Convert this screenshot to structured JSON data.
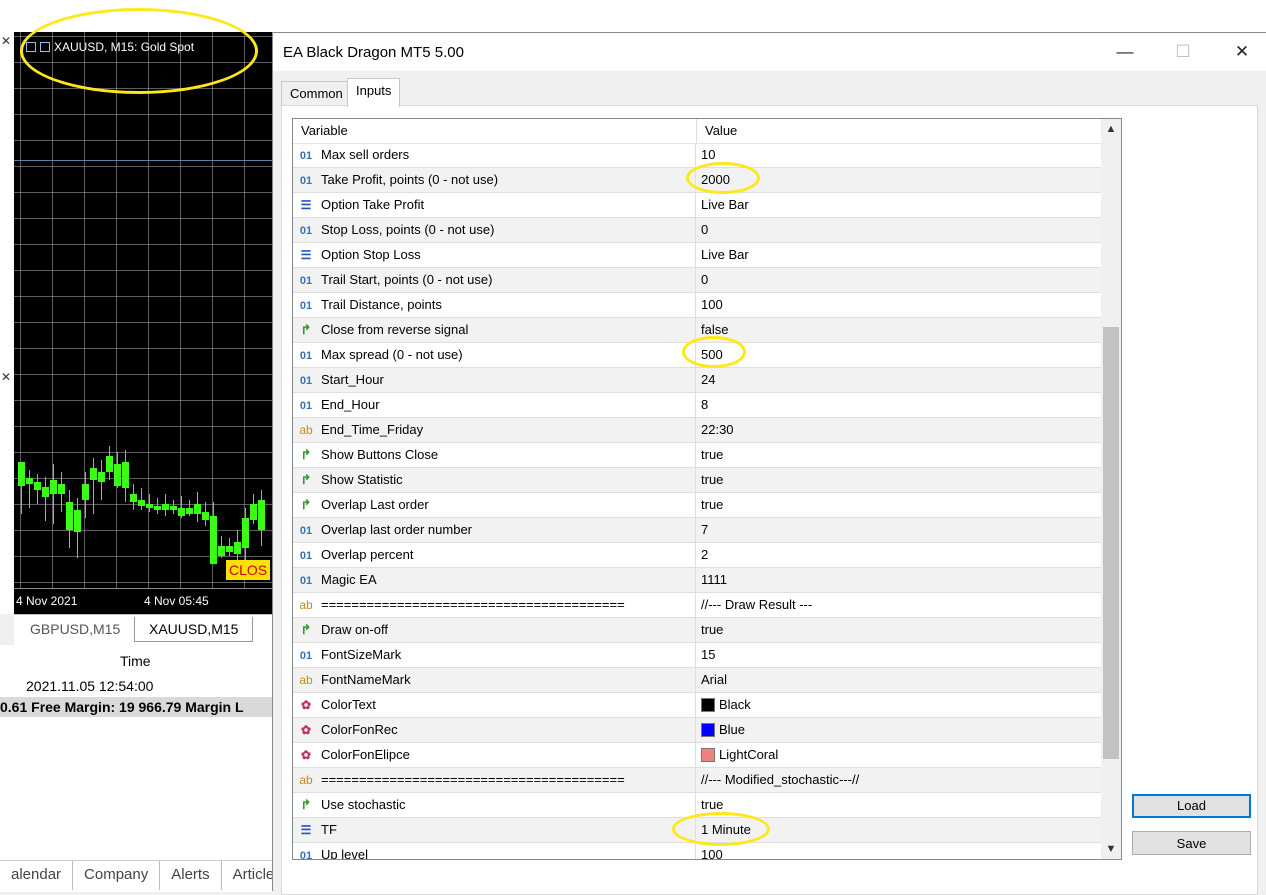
{
  "terminal": {
    "chart": {
      "title": "XAUUSD, M15:  Gold Spot",
      "axis_left": "4 Nov 2021",
      "axis_right": "4 Nov 05:45",
      "close_label": "CLOS"
    },
    "chart_tabs": [
      "GBPUSD,M15",
      "XAUUSD,M15"
    ],
    "toolbox": {
      "time_header": "Time",
      "date_value": "2021.11.05 12:54:00",
      "balance_text": "0.61  Free Margin: 19 966.79  Margin L"
    },
    "bottom_tabs": [
      "alendar",
      "Company",
      "Alerts",
      "Articles"
    ]
  },
  "dialog": {
    "title": "EA Black Dragon MT5 5.00",
    "window_buttons": {
      "minimize": "—",
      "maximize": "☐",
      "close": "✕"
    },
    "tabs": [
      {
        "label": "Common",
        "active": false
      },
      {
        "label": "Inputs",
        "active": true
      }
    ],
    "grid": {
      "headers": {
        "variable": "Variable",
        "value": "Value"
      },
      "rows": [
        {
          "type": "int",
          "icon": "01",
          "variable": "Max sell orders",
          "value": "10"
        },
        {
          "type": "int",
          "icon": "01",
          "variable": "Take Profit, points (0 - not use)",
          "value": "2000"
        },
        {
          "type": "enum",
          "icon": "☰",
          "variable": "Option Take Profit",
          "value": "Live Bar"
        },
        {
          "type": "int",
          "icon": "01",
          "variable": "Stop Loss, points (0 - not use)",
          "value": "0"
        },
        {
          "type": "enum",
          "icon": "☰",
          "variable": "Option Stop Loss",
          "value": "Live Bar"
        },
        {
          "type": "int",
          "icon": "01",
          "variable": "Trail Start, points (0 - not use)",
          "value": "0"
        },
        {
          "type": "int",
          "icon": "01",
          "variable": "Trail Distance, points",
          "value": "100"
        },
        {
          "type": "bool",
          "icon": "↱",
          "variable": "Close from reverse signal",
          "value": "false"
        },
        {
          "type": "int",
          "icon": "01",
          "variable": "Max spread (0 - not use)",
          "value": "500"
        },
        {
          "type": "int",
          "icon": "01",
          "variable": "Start_Hour",
          "value": "24"
        },
        {
          "type": "int",
          "icon": "01",
          "variable": "End_Hour",
          "value": "8"
        },
        {
          "type": "str",
          "icon": "ab",
          "variable": "End_Time_Friday",
          "value": "22:30"
        },
        {
          "type": "bool",
          "icon": "↱",
          "variable": "Show Buttons Close",
          "value": "true"
        },
        {
          "type": "bool",
          "icon": "↱",
          "variable": "Show Statistic",
          "value": "true"
        },
        {
          "type": "bool",
          "icon": "↱",
          "variable": "Overlap Last order",
          "value": "true"
        },
        {
          "type": "int",
          "icon": "01",
          "variable": "Overlap last order number",
          "value": "7"
        },
        {
          "type": "int",
          "icon": "01",
          "variable": "Overlap percent",
          "value": "2"
        },
        {
          "type": "int",
          "icon": "01",
          "variable": "Magic EA",
          "value": "1111"
        },
        {
          "type": "str",
          "icon": "ab",
          "variable": "========================================",
          "value": "//--- Draw Result ---"
        },
        {
          "type": "bool",
          "icon": "↱",
          "variable": "Draw on-off",
          "value": "true"
        },
        {
          "type": "int",
          "icon": "01",
          "variable": "FontSizeMark",
          "value": "15"
        },
        {
          "type": "str",
          "icon": "ab",
          "variable": "FontNameMark",
          "value": "Arial"
        },
        {
          "type": "color",
          "icon": "✿",
          "variable": "ColorText",
          "value": "Black",
          "swatch": "#000000"
        },
        {
          "type": "color",
          "icon": "✿",
          "variable": "ColorFonRec",
          "value": "Blue",
          "swatch": "#0000ff"
        },
        {
          "type": "color",
          "icon": "✿",
          "variable": "ColorFonElipce",
          "value": "LightCoral",
          "swatch": "#f08080"
        },
        {
          "type": "str",
          "icon": "ab",
          "variable": "========================================",
          "value": "//--- Modified_stochastic---//"
        },
        {
          "type": "bool",
          "icon": "↱",
          "variable": "Use stochastic",
          "value": "true"
        },
        {
          "type": "enum",
          "icon": "☰",
          "variable": "TF",
          "value": "1 Minute"
        },
        {
          "type": "int",
          "icon": "01",
          "variable": "Up level",
          "value": "100"
        }
      ]
    },
    "buttons": {
      "load": "Load",
      "save": "Save"
    }
  },
  "colors": {
    "annotation": "#ffe81a",
    "candle": "#39ff14",
    "chart_bg": "#000000",
    "default_button_border": "#0078d7"
  }
}
